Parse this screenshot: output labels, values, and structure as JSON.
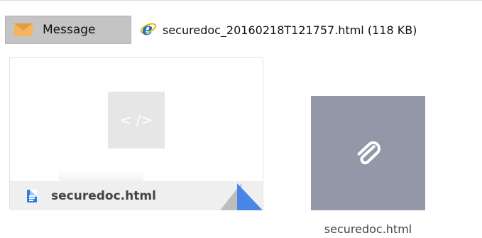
{
  "attachment_bar": {
    "message_tab": {
      "label": "Message",
      "icon": "envelope-icon"
    },
    "file": {
      "name": "securedoc_20160218T121757.html (118 KB)",
      "icon": "internet-explorer-icon"
    }
  },
  "preview_card": {
    "code_glyph": "< />",
    "file_name": "securedoc.html",
    "file_icon": "document-icon"
  },
  "attachment_tile": {
    "icon": "paperclip-icon",
    "caption": "securedoc.html"
  },
  "colors": {
    "tab_bg": "#c4c4c4",
    "envelope": "#f5b560",
    "tile_bg": "#9298a8",
    "accent_blue": "#4a86e8"
  }
}
